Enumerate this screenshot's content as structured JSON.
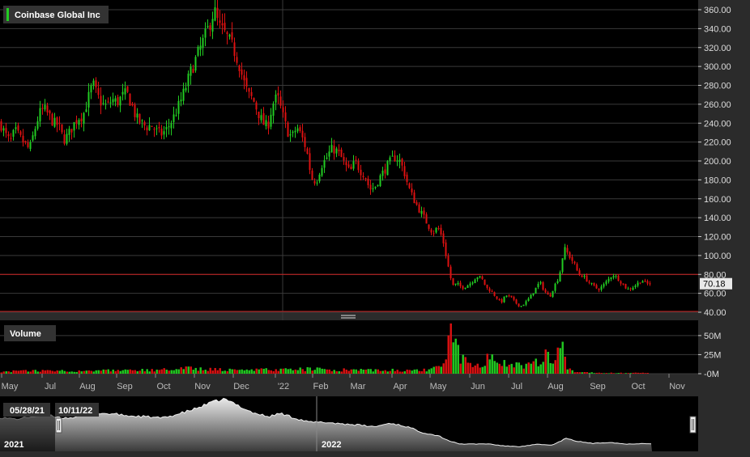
{
  "chart_data": {
    "type": "candlestick",
    "title": "Coinbase Global Inc",
    "last_price_label": "70.18",
    "last_price": 70.18,
    "price_axis": {
      "ticks": [
        360,
        340,
        320,
        300,
        280,
        260,
        240,
        220,
        200,
        180,
        160,
        140,
        120,
        100,
        80,
        60,
        40
      ],
      "tick_labels": [
        "360.00",
        "340.00",
        "320.00",
        "300.00",
        "280.00",
        "260.00",
        "240.00",
        "220.00",
        "200.00",
        "180.00",
        "160.00",
        "140.00",
        "120.00",
        "100.00",
        "80.00",
        "60.00",
        "40.00"
      ],
      "range": [
        40,
        370
      ]
    },
    "volume_panel": {
      "title": "Volume",
      "tick_labels": [
        "50M",
        "25M",
        "-0M"
      ],
      "ticks": [
        50,
        25,
        0
      ],
      "unit": "M",
      "range": [
        0,
        70
      ]
    },
    "x_axis": {
      "labels": [
        "May",
        "Jul",
        "Aug",
        "Sep",
        "Oct",
        "Nov",
        "Dec",
        "'22",
        "Feb",
        "Mar",
        "Apr",
        "May",
        "Jun",
        "Jul",
        "Aug",
        "Sep",
        "Oct",
        "Nov"
      ]
    },
    "navigator": {
      "start_label": "05/28/21",
      "end_label": "10/11/22",
      "year_labels": [
        "2021",
        "2022"
      ]
    },
    "colors": {
      "up": "#22cc22",
      "down": "#dd1111",
      "background": "#000000",
      "grid": "#3a3a3a",
      "frame": "#2b2b2b",
      "level_line": "#cc2222"
    },
    "level_lines": [
      80,
      40
    ],
    "price_path": [
      [
        0,
        240
      ],
      [
        6,
        228
      ],
      [
        12,
        220
      ],
      [
        18,
        232
      ],
      [
        24,
        225
      ],
      [
        30,
        218
      ],
      [
        36,
        212
      ],
      [
        42,
        232
      ],
      [
        48,
        250
      ],
      [
        54,
        255
      ],
      [
        60,
        248
      ],
      [
        66,
        240
      ],
      [
        72,
        238
      ],
      [
        78,
        222
      ],
      [
        84,
        228
      ],
      [
        90,
        238
      ],
      [
        96,
        246
      ],
      [
        102,
        248
      ],
      [
        108,
        265
      ],
      [
        114,
        282
      ],
      [
        120,
        268
      ],
      [
        126,
        260
      ],
      [
        132,
        258
      ],
      [
        138,
        265
      ],
      [
        144,
        262
      ],
      [
        150,
        268
      ],
      [
        156,
        272
      ],
      [
        162,
        260
      ],
      [
        168,
        245
      ],
      [
        174,
        240
      ],
      [
        180,
        236
      ],
      [
        186,
        238
      ],
      [
        192,
        232
      ],
      [
        198,
        228
      ],
      [
        204,
        232
      ],
      [
        210,
        240
      ],
      [
        216,
        250
      ],
      [
        222,
        262
      ],
      [
        228,
        276
      ],
      [
        234,
        292
      ],
      [
        240,
        305
      ],
      [
        246,
        318
      ],
      [
        252,
        330
      ],
      [
        258,
        344
      ],
      [
        264,
        360
      ],
      [
        270,
        342
      ],
      [
        276,
        336
      ],
      [
        282,
        328
      ],
      [
        288,
        318
      ],
      [
        294,
        305
      ],
      [
        300,
        285
      ],
      [
        306,
        270
      ],
      [
        312,
        265
      ],
      [
        318,
        252
      ],
      [
        324,
        240
      ],
      [
        330,
        236
      ],
      [
        336,
        260
      ],
      [
        342,
        268
      ],
      [
        348,
        250
      ],
      [
        354,
        232
      ],
      [
        360,
        225
      ],
      [
        366,
        236
      ],
      [
        372,
        226
      ],
      [
        378,
        212
      ],
      [
        384,
        182
      ],
      [
        390,
        178
      ],
      [
        396,
        195
      ],
      [
        402,
        202
      ],
      [
        408,
        212
      ],
      [
        414,
        212
      ],
      [
        420,
        205
      ],
      [
        426,
        195
      ],
      [
        432,
        188
      ],
      [
        438,
        200
      ],
      [
        444,
        190
      ],
      [
        450,
        185
      ],
      [
        456,
        170
      ],
      [
        462,
        172
      ],
      [
        468,
        182
      ],
      [
        474,
        190
      ],
      [
        480,
        198
      ],
      [
        486,
        204
      ],
      [
        492,
        202
      ],
      [
        498,
        190
      ],
      [
        504,
        172
      ],
      [
        510,
        160
      ],
      [
        516,
        150
      ],
      [
        522,
        142
      ],
      [
        528,
        132
      ],
      [
        534,
        124
      ],
      [
        540,
        130
      ],
      [
        546,
        118
      ],
      [
        552,
        92
      ],
      [
        558,
        68
      ],
      [
        564,
        70
      ],
      [
        570,
        66
      ],
      [
        576,
        68
      ],
      [
        582,
        72
      ],
      [
        588,
        78
      ],
      [
        594,
        76
      ],
      [
        600,
        66
      ],
      [
        606,
        62
      ],
      [
        612,
        56
      ],
      [
        618,
        50
      ],
      [
        624,
        58
      ],
      [
        630,
        56
      ],
      [
        636,
        50
      ],
      [
        642,
        46
      ],
      [
        648,
        50
      ],
      [
        654,
        56
      ],
      [
        660,
        64
      ],
      [
        666,
        72
      ],
      [
        672,
        62
      ],
      [
        678,
        56
      ],
      [
        684,
        68
      ],
      [
        690,
        78
      ],
      [
        696,
        108
      ],
      [
        702,
        100
      ],
      [
        708,
        92
      ],
      [
        714,
        80
      ],
      [
        720,
        78
      ],
      [
        726,
        72
      ],
      [
        732,
        68
      ],
      [
        738,
        64
      ],
      [
        744,
        68
      ],
      [
        750,
        74
      ],
      [
        756,
        80
      ],
      [
        762,
        76
      ],
      [
        768,
        70
      ],
      [
        774,
        64
      ],
      [
        780,
        66
      ],
      [
        786,
        70
      ],
      [
        792,
        74
      ],
      [
        798,
        70
      ],
      [
        802,
        70.18
      ]
    ],
    "volume_path": [
      [
        0,
        3
      ],
      [
        60,
        4
      ],
      [
        110,
        4
      ],
      [
        150,
        4
      ],
      [
        200,
        5
      ],
      [
        230,
        7
      ],
      [
        250,
        6
      ],
      [
        300,
        5
      ],
      [
        350,
        5
      ],
      [
        380,
        6
      ],
      [
        420,
        5
      ],
      [
        470,
        5
      ],
      [
        520,
        4
      ],
      [
        548,
        10
      ],
      [
        556,
        65
      ],
      [
        562,
        32
      ],
      [
        568,
        22
      ],
      [
        576,
        18
      ],
      [
        584,
        14
      ],
      [
        592,
        12
      ],
      [
        600,
        18
      ],
      [
        608,
        22
      ],
      [
        616,
        16
      ],
      [
        624,
        13
      ],
      [
        632,
        12
      ],
      [
        640,
        11
      ],
      [
        648,
        10
      ],
      [
        656,
        13
      ],
      [
        664,
        16
      ],
      [
        672,
        24
      ],
      [
        680,
        20
      ],
      [
        688,
        27
      ],
      [
        692,
        52
      ],
      [
        696,
        26
      ],
      [
        700,
        8
      ],
      [
        710,
        2
      ],
      [
        740,
        1
      ],
      [
        800,
        1
      ]
    ],
    "navigator_path": [
      [
        0,
        236
      ],
      [
        20,
        225
      ],
      [
        40,
        242
      ],
      [
        60,
        248
      ],
      [
        80,
        232
      ],
      [
        100,
        242
      ],
      [
        120,
        262
      ],
      [
        140,
        258
      ],
      [
        160,
        245
      ],
      [
        180,
        240
      ],
      [
        200,
        232
      ],
      [
        220,
        258
      ],
      [
        240,
        290
      ],
      [
        260,
        330
      ],
      [
        275,
        352
      ],
      [
        290,
        320
      ],
      [
        310,
        268
      ],
      [
        330,
        240
      ],
      [
        345,
        262
      ],
      [
        360,
        236
      ],
      [
        380,
        206
      ],
      [
        400,
        204
      ],
      [
        420,
        196
      ],
      [
        440,
        188
      ],
      [
        460,
        176
      ],
      [
        480,
        200
      ],
      [
        500,
        178
      ],
      [
        520,
        140
      ],
      [
        540,
        118
      ],
      [
        552,
        88
      ],
      [
        564,
        68
      ],
      [
        580,
        66
      ],
      [
        600,
        68
      ],
      [
        620,
        54
      ],
      [
        640,
        50
      ],
      [
        660,
        64
      ],
      [
        680,
        60
      ],
      [
        696,
        102
      ],
      [
        710,
        84
      ],
      [
        730,
        70
      ],
      [
        750,
        78
      ],
      [
        770,
        66
      ],
      [
        790,
        70
      ],
      [
        802,
        70
      ]
    ]
  }
}
